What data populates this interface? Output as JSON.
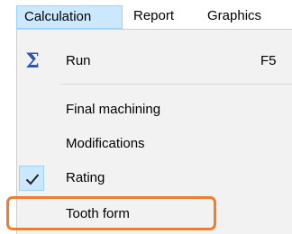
{
  "menubar": {
    "items": [
      {
        "label": "Calculation",
        "active": true
      },
      {
        "label": "Report"
      },
      {
        "label": "Graphics"
      }
    ]
  },
  "menu": {
    "run": {
      "label": "Run",
      "shortcut": "F5",
      "icon": "sigma-icon"
    },
    "final_machining": {
      "label": "Final machining"
    },
    "modifications": {
      "label": "Modifications"
    },
    "rating": {
      "label": "Rating",
      "checked": true,
      "icon": "checkmark-icon"
    },
    "tooth_form": {
      "label": "Tooth form",
      "highlighted": true
    }
  },
  "colors": {
    "menu_background": "#f2f2f2",
    "active_menubar_fill": "#cce8ff",
    "active_menubar_border": "#99d1ff",
    "sigma_icon": "#2a56b4",
    "checkmark": "#1f1f1f",
    "highlight_outline": "#ef7d2c"
  }
}
